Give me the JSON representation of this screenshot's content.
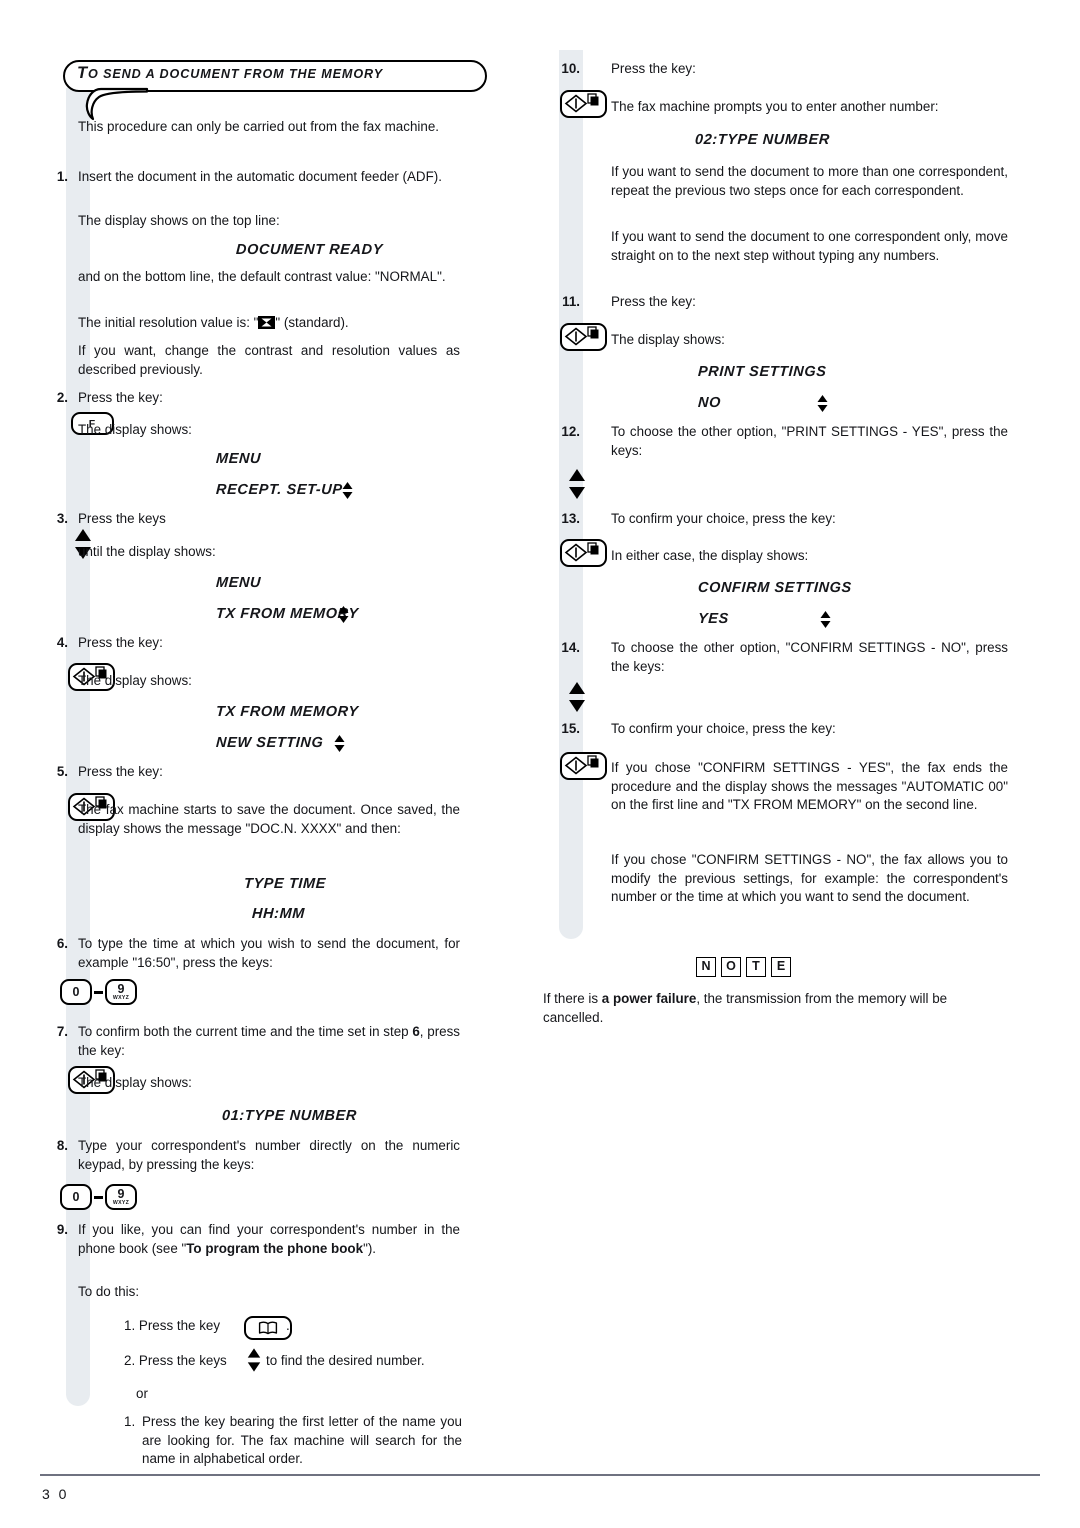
{
  "header": {
    "title_cap": "T",
    "title_rest": "O SEND A DOCUMENT FROM THE MEMORY"
  },
  "left_column": {
    "intro": "This procedure can only be carried out from the fax machine.",
    "steps": [
      {
        "num": "1.",
        "text": "Insert the document in the automatic document feeder (ADF)."
      },
      {
        "num": "2.",
        "text": "Press the key:"
      },
      {
        "num": "3.",
        "text": "Press the keys"
      },
      {
        "num": "4.",
        "text": "Press the key:"
      },
      {
        "num": "5.",
        "text": "Press the key:"
      },
      {
        "num": "6.",
        "text": "To type the time at which you wish to send the document, for example \"16:50\", press the keys:"
      },
      {
        "num": "7.",
        "text_a": "To confirm both the current time and the time set in step ",
        "text_b": "6",
        "text_c": ", press the key:"
      },
      {
        "num": "8.",
        "text": "Type your correspondent's number directly on the numeric keypad, by pressing the keys:"
      },
      {
        "num": "9.",
        "text_a": "If you like, you can find your correspondent's number in the phone book (see \"",
        "text_b": "To program the phone book",
        "text_c": "\")."
      }
    ],
    "line_display_top": "The display shows on the top line:",
    "line_display_shows_1": "The display shows:",
    "line_display_shows_2": "The display shows:",
    "line_display_shows_3": "The display shows:",
    "line_display_shows_4": "The display shows:",
    "line_bottom_contrast": "and on the bottom line, the default contrast value: \"NORMAL\".",
    "line_resolution_a": "The initial resolution value is: \"",
    "line_resolution_b": "\" (standard).",
    "line_change": "If you want, change the contrast and resolution values as described previously.",
    "line_until": "until the display shows:",
    "line_saving": "The fax machine starts to save the document. Once saved, the display shows the message \"DOC.N. XXXX\" and then:",
    "line_todothis": "To do this:",
    "sub_steps": [
      {
        "num": "1.",
        "text": "Press the key"
      },
      {
        "num": "2.",
        "text_a": "Press the keys",
        "text_b": "to find the desired number."
      },
      {
        "text": "or"
      },
      {
        "num": "1.",
        "text": "Press the key bearing the first letter of the name you are looking for. The fax machine will search for the name in alphabetical order."
      }
    ],
    "lcd": {
      "document_ready": "DOCUMENT READY",
      "menu_1": "MENU",
      "recept_setup": "RECEPT. SET-UP",
      "menu_2": "MENU",
      "tx_from_memory_1": "TX FROM MEMORY",
      "tx_from_memory_2": "TX FROM MEMORY",
      "new_setting": "NEW SETTING",
      "type_time": "TYPE TIME",
      "hhmm": "HH:MM",
      "type_number_01": "01:TYPE NUMBER"
    },
    "keys": {
      "f": "F",
      "zero": "0",
      "nine_digit": "9",
      "nine_letters": "WXYZ"
    }
  },
  "right_column": {
    "steps": [
      {
        "num": "10.",
        "text": "Press the key:"
      },
      {
        "num": "11.",
        "text": "Press the key:"
      },
      {
        "num": "12.",
        "text": "To choose the other option, \"PRINT SETTINGS - YES\", press the keys:"
      },
      {
        "num": "13.",
        "text": "To confirm your choice, press the key:"
      },
      {
        "num": "14.",
        "text": "To choose the other option, \"CONFIRM SETTINGS - NO\", press the keys:"
      },
      {
        "num": "15.",
        "text": "To confirm your choice, press the key:"
      }
    ],
    "line_prompt_another": "The fax machine prompts you to enter another number:",
    "line_more_than_one": "If you want to send the document to more than one correspondent, repeat the previous two steps once for each correspondent.",
    "line_one_only": "If you want to send the document to one correspondent only, move straight on to the next step without typing any numbers.",
    "line_display_shows": "The display shows:",
    "line_either_case": "In either case, the display shows:",
    "line_yes_result": "If you chose \"CONFIRM SETTINGS - YES\", the fax ends the procedure and the display shows the messages \"AUTOMATIC   00\" on the first line and \"TX FROM MEMORY\" on the second line.",
    "line_no_result": "If you chose \"CONFIRM SETTINGS - NO\", the fax allows you to modify the previous settings, for example: the correspondent's number or the time at which you want to send the document.",
    "lcd": {
      "type_number_02": "02:TYPE NUMBER",
      "print_settings": "PRINT SETTINGS",
      "no": "NO",
      "confirm_settings": "CONFIRM SETTINGS",
      "yes": "YES"
    }
  },
  "note": {
    "badge_letters": [
      "N",
      "O",
      "T",
      "E"
    ],
    "text_a": "If there is ",
    "text_b": "a power failure",
    "text_c": ", the transmission from the memory will be cancelled."
  },
  "footer": {
    "page_number": "3 0"
  },
  "colors": {
    "band": "#e8ecf0",
    "rule": "#6f7280",
    "ink": "#15161a"
  }
}
